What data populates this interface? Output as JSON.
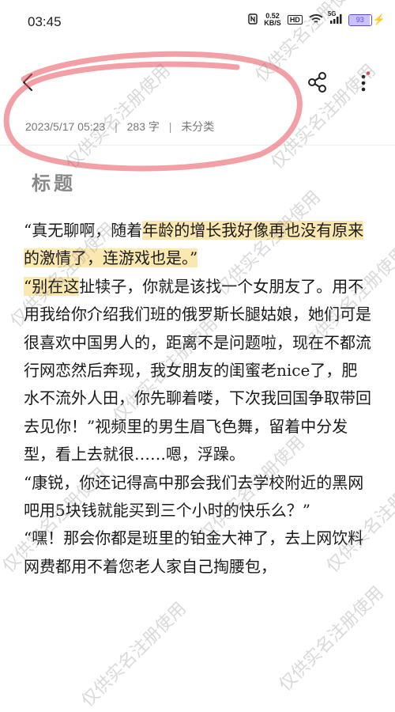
{
  "status": {
    "time": "03:45",
    "net_speed_value": "0.52",
    "net_speed_unit": "KB/S",
    "hd": "HD",
    "signal": "5G",
    "battery": "93",
    "battery_level": 0.93
  },
  "meta": {
    "datetime": "2023/5/17 05:23",
    "words": "283 字",
    "category": "未分类"
  },
  "title": "标题",
  "paragraphs": [
    {
      "segments": [
        {
          "text": "“真无聊啊，随着",
          "hl": false
        },
        {
          "text": "年龄的增长我好像再也没有原来的激情了，",
          "hl": true
        },
        {
          "text": "连游戏也是。”",
          "hl": true
        }
      ]
    },
    {
      "segments": [
        {
          "text": "“别在这",
          "hl": true
        },
        {
          "text": "扯犊子，你就是该找一个女朋友了。用不用我给你介绍我们班的俄罗斯长腿姑娘，她们可是很喜欢中国男人的，距离不是问题啦，现在不都流行网恋然后奔现，我女朋友的闺蜜老nice了，肥水不流外人田，你先聊着喽，下次我回国争取带回去见你！”视频里的男生眉飞色舞，留着中分发型，看上去就很……嗯，浮躁。",
          "hl": false
        }
      ]
    },
    {
      "segments": [
        {
          "text": "“康锐，你还记得高中那会我们去学校附近的黑网吧用5块钱就能买到三个小时的快乐么？”",
          "hl": false
        }
      ]
    },
    {
      "segments": [
        {
          "text": "“嘿！那会你都是班里的铂金大神了，去上网饮料网费都用不着您老人家自己掏腰包，",
          "hl": false
        }
      ]
    }
  ],
  "watermark": "仅供实名注册使用",
  "accent": "#e8505b",
  "highlight_color": "#fbe8b0"
}
